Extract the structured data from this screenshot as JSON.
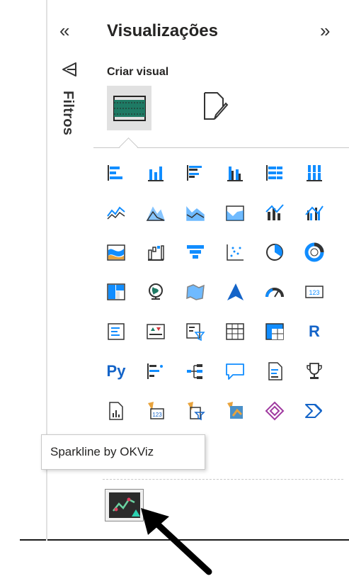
{
  "filters_pane": {
    "label": "Filtros",
    "collapse_glyph": "«"
  },
  "visualizations_pane": {
    "title": "Visualizações",
    "collapse_glyph": "»",
    "build_section_label": "Criar visual"
  },
  "tooltip": {
    "text": "Sparkline by OKViz"
  },
  "grid_text_icons": {
    "r_visual": "R",
    "python_visual": "Py"
  },
  "colors": {
    "accent_teal": "#1e7a64",
    "powerbi_blue": "#118dff",
    "dark": "#252423"
  }
}
